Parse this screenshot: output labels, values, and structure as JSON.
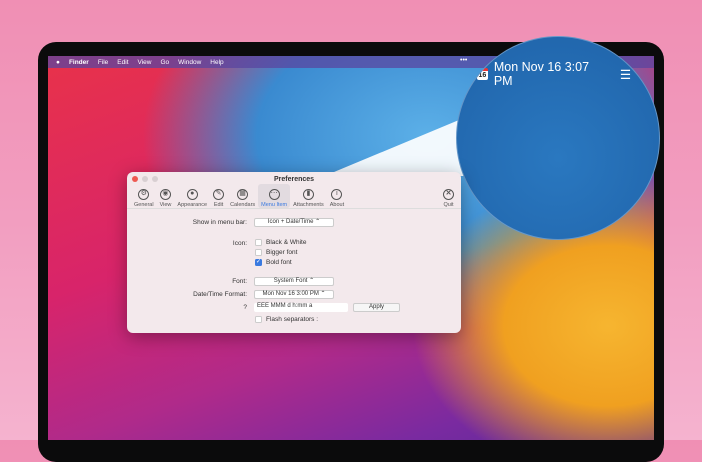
{
  "menubar": {
    "apple": "",
    "items": [
      "Finder",
      "File",
      "Edit",
      "View",
      "Go",
      "Window",
      "Help"
    ],
    "overflow": "•••"
  },
  "magnifier": {
    "calendar_day": "16",
    "datetime": "Mon Nov 16 3:07 PM"
  },
  "window": {
    "title": "Preferences",
    "toolbar": [
      {
        "label": "General",
        "icon": "⚙"
      },
      {
        "label": "View",
        "icon": "◉"
      },
      {
        "label": "Appearance",
        "icon": "●"
      },
      {
        "label": "Edit",
        "icon": "✎"
      },
      {
        "label": "Calendars",
        "icon": "▦"
      },
      {
        "label": "Menu Item",
        "icon": "⋯"
      },
      {
        "label": "Attachments",
        "icon": "▮"
      },
      {
        "label": "About",
        "icon": "i"
      }
    ],
    "quit": {
      "label": "Quit",
      "icon": "✕"
    },
    "show_label": "Show in menu bar:",
    "show_value": "Icon + Date/Time",
    "icon_label": "Icon:",
    "options": [
      {
        "label": "Black & White",
        "checked": false
      },
      {
        "label": "Bigger font",
        "checked": false
      },
      {
        "label": "Bold font",
        "checked": true
      }
    ],
    "font_label": "Font:",
    "font_value": "System Font",
    "format_label": "Date/Time Format:",
    "format_value": "Mon Nov 16 3:00 PM",
    "help": "?",
    "format_string": "EEE MMM d h:mm a",
    "apply": "Apply",
    "flash": "Flash separators :"
  },
  "colors": {
    "accent": "#3a7ae0"
  }
}
